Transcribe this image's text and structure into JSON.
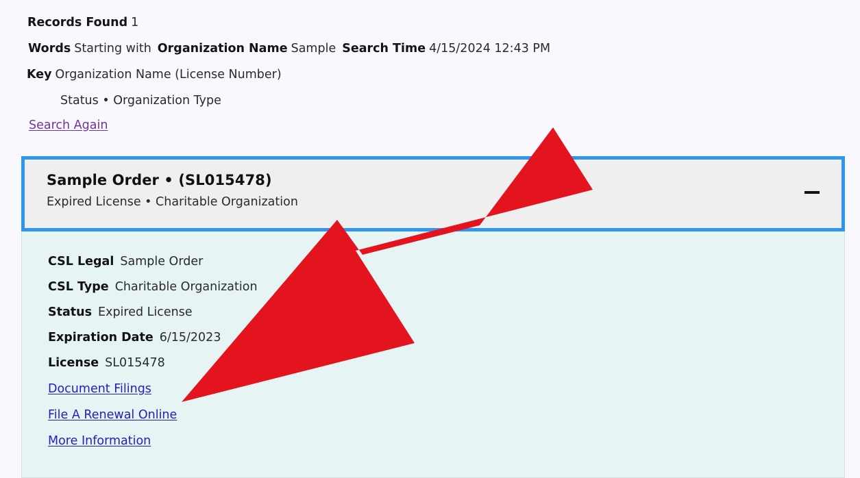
{
  "summary": {
    "records_found_label": "Records Found",
    "records_found_value": "1",
    "words_label": "Words",
    "words_value": "Starting with",
    "organization_name_label": "Organization Name",
    "organization_name_value": "Sample",
    "search_time_label": "Search Time",
    "search_time_value": "4/15/2024 12:43 PM",
    "key_label": "Key",
    "key_value": "Organization Name (License Number)",
    "key_detail": "Status • Organization Type",
    "search_again_link": "Search Again"
  },
  "result_card": {
    "org_title": "Sample Order • (SL015478)",
    "org_subtitle": "Expired License • Charitable Organization",
    "collapse_icon": "minus-icon",
    "fields": [
      {
        "label": "CSL Legal",
        "value": "Sample Order"
      },
      {
        "label": "CSL Type",
        "value": "Charitable Organization"
      },
      {
        "label": "Status",
        "value": "Expired License"
      },
      {
        "label": "Expiration Date",
        "value": "6/15/2023"
      },
      {
        "label": "License",
        "value": "SL015478"
      }
    ],
    "links": [
      "Document Filings",
      "File A Renewal Online",
      "More Information"
    ]
  },
  "annotation": {
    "arrow_icon": "red-arrow-pointing-down-left",
    "arrow_color": "#e3141e",
    "highlight_color": "#2f95ee"
  },
  "colors": {
    "page_background": "#f9f8fd",
    "card_header_background": "#f0eff0",
    "card_body_background": "#e7f4f4",
    "link_purple": "#7230a3",
    "link_blue": "#1f1fbe"
  }
}
